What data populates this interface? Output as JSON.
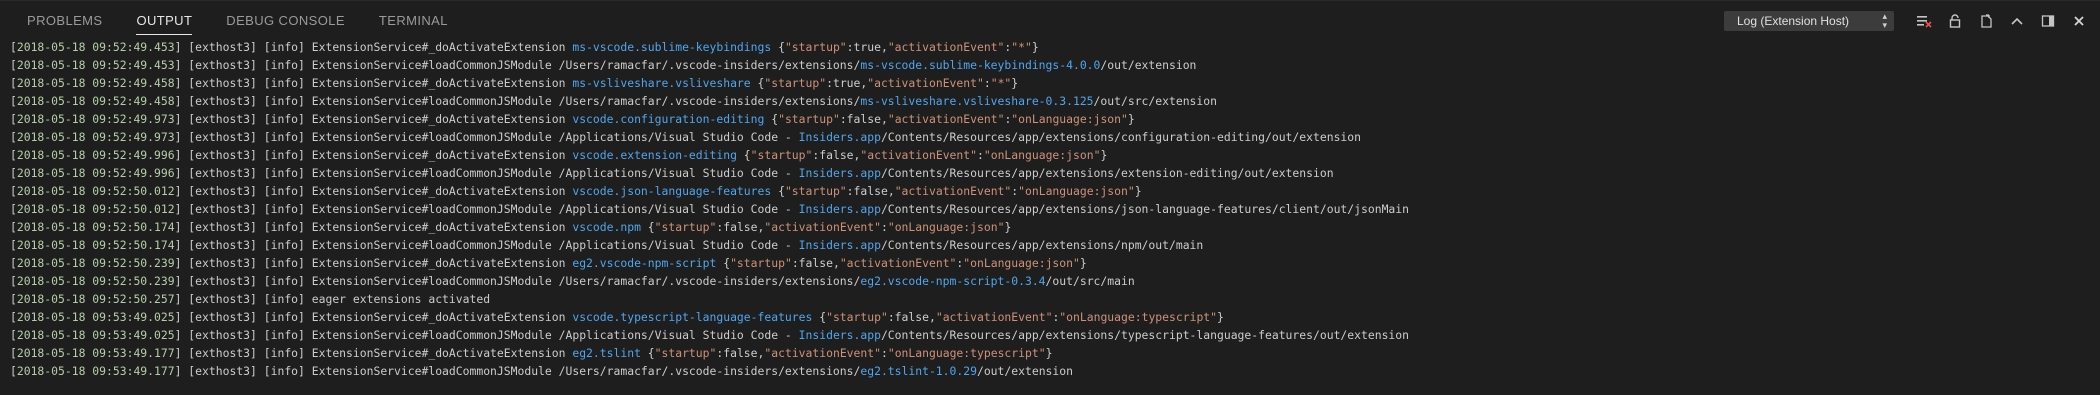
{
  "tabs": [
    {
      "label": "PROBLEMS",
      "active": false
    },
    {
      "label": "OUTPUT",
      "active": true
    },
    {
      "label": "DEBUG CONSOLE",
      "active": false
    },
    {
      "label": "TERMINAL",
      "active": false
    }
  ],
  "channel_select": {
    "selected": "Log (Extension Host)"
  },
  "toolbar_icons": [
    "clear-output-icon",
    "lock-scroll-icon",
    "open-log-file-icon",
    "maximize-panel-icon",
    "toggle-panel-position-icon",
    "close-panel-icon"
  ],
  "colors": {
    "background": "#1e1e1e",
    "timestamp": "#b5cea8",
    "string": "#ce9178",
    "link": "#4fa6ee"
  },
  "log_lines": [
    [
      {
        "t": "[",
        "c": ""
      },
      {
        "t": "2018-05-18 09:52:49.453",
        "c": "ts"
      },
      {
        "t": "] [exthost3] [info] ExtensionService#_doActivateExtension ",
        "c": ""
      },
      {
        "t": "ms-vscode.sublime-keybindings",
        "c": "lnk"
      },
      {
        "t": " {",
        "c": ""
      },
      {
        "t": "\"startup\"",
        "c": "str"
      },
      {
        "t": ":true,",
        "c": ""
      },
      {
        "t": "\"activationEvent\"",
        "c": "str"
      },
      {
        "t": ":",
        "c": ""
      },
      {
        "t": "\"*\"",
        "c": "str"
      },
      {
        "t": "}",
        "c": ""
      }
    ],
    [
      {
        "t": "[",
        "c": ""
      },
      {
        "t": "2018-05-18 09:52:49.453",
        "c": "ts"
      },
      {
        "t": "] [exthost3] [info] ExtensionService#loadCommonJSModule /Users/ramacfar/.vscode-insiders/extensions/",
        "c": ""
      },
      {
        "t": "ms-vscode.sublime-keybindings-4.0.0",
        "c": "lnk"
      },
      {
        "t": "/out/extension",
        "c": ""
      }
    ],
    [
      {
        "t": "[",
        "c": ""
      },
      {
        "t": "2018-05-18 09:52:49.458",
        "c": "ts"
      },
      {
        "t": "] [exthost3] [info] ExtensionService#_doActivateExtension ",
        "c": ""
      },
      {
        "t": "ms-vsliveshare.vsliveshare",
        "c": "lnk"
      },
      {
        "t": " {",
        "c": ""
      },
      {
        "t": "\"startup\"",
        "c": "str"
      },
      {
        "t": ":true,",
        "c": ""
      },
      {
        "t": "\"activationEvent\"",
        "c": "str"
      },
      {
        "t": ":",
        "c": ""
      },
      {
        "t": "\"*\"",
        "c": "str"
      },
      {
        "t": "}",
        "c": ""
      }
    ],
    [
      {
        "t": "[",
        "c": ""
      },
      {
        "t": "2018-05-18 09:52:49.458",
        "c": "ts"
      },
      {
        "t": "] [exthost3] [info] ExtensionService#loadCommonJSModule /Users/ramacfar/.vscode-insiders/extensions/",
        "c": ""
      },
      {
        "t": "ms-vsliveshare.vsliveshare-0.3.125",
        "c": "lnk"
      },
      {
        "t": "/out/src/extension",
        "c": ""
      }
    ],
    [
      {
        "t": "[",
        "c": ""
      },
      {
        "t": "2018-05-18 09:52:49.973",
        "c": "ts"
      },
      {
        "t": "] [exthost3] [info] ExtensionService#_doActivateExtension ",
        "c": ""
      },
      {
        "t": "vscode.configuration-editing",
        "c": "lnk"
      },
      {
        "t": " {",
        "c": ""
      },
      {
        "t": "\"startup\"",
        "c": "str"
      },
      {
        "t": ":false,",
        "c": ""
      },
      {
        "t": "\"activationEvent\"",
        "c": "str"
      },
      {
        "t": ":",
        "c": ""
      },
      {
        "t": "\"onLanguage:json\"",
        "c": "str"
      },
      {
        "t": "}",
        "c": ""
      }
    ],
    [
      {
        "t": "[",
        "c": ""
      },
      {
        "t": "2018-05-18 09:52:49.973",
        "c": "ts"
      },
      {
        "t": "] [exthost3] [info] ExtensionService#loadCommonJSModule /Applications/Visual Studio Code - ",
        "c": ""
      },
      {
        "t": "Insiders.app",
        "c": "lnk"
      },
      {
        "t": "/Contents/Resources/app/extensions/configuration-editing/out/extension",
        "c": ""
      }
    ],
    [
      {
        "t": "[",
        "c": ""
      },
      {
        "t": "2018-05-18 09:52:49.996",
        "c": "ts"
      },
      {
        "t": "] [exthost3] [info] ExtensionService#_doActivateExtension ",
        "c": ""
      },
      {
        "t": "vscode.extension-editing",
        "c": "lnk"
      },
      {
        "t": " {",
        "c": ""
      },
      {
        "t": "\"startup\"",
        "c": "str"
      },
      {
        "t": ":false,",
        "c": ""
      },
      {
        "t": "\"activationEvent\"",
        "c": "str"
      },
      {
        "t": ":",
        "c": ""
      },
      {
        "t": "\"onLanguage:json\"",
        "c": "str"
      },
      {
        "t": "}",
        "c": ""
      }
    ],
    [
      {
        "t": "[",
        "c": ""
      },
      {
        "t": "2018-05-18 09:52:49.996",
        "c": "ts"
      },
      {
        "t": "] [exthost3] [info] ExtensionService#loadCommonJSModule /Applications/Visual Studio Code - ",
        "c": ""
      },
      {
        "t": "Insiders.app",
        "c": "lnk"
      },
      {
        "t": "/Contents/Resources/app/extensions/extension-editing/out/extension",
        "c": ""
      }
    ],
    [
      {
        "t": "[",
        "c": ""
      },
      {
        "t": "2018-05-18 09:52:50.012",
        "c": "ts"
      },
      {
        "t": "] [exthost3] [info] ExtensionService#_doActivateExtension ",
        "c": ""
      },
      {
        "t": "vscode.json-language-features",
        "c": "lnk"
      },
      {
        "t": " {",
        "c": ""
      },
      {
        "t": "\"startup\"",
        "c": "str"
      },
      {
        "t": ":false,",
        "c": ""
      },
      {
        "t": "\"activationEvent\"",
        "c": "str"
      },
      {
        "t": ":",
        "c": ""
      },
      {
        "t": "\"onLanguage:json\"",
        "c": "str"
      },
      {
        "t": "}",
        "c": ""
      }
    ],
    [
      {
        "t": "[",
        "c": ""
      },
      {
        "t": "2018-05-18 09:52:50.012",
        "c": "ts"
      },
      {
        "t": "] [exthost3] [info] ExtensionService#loadCommonJSModule /Applications/Visual Studio Code - ",
        "c": ""
      },
      {
        "t": "Insiders.app",
        "c": "lnk"
      },
      {
        "t": "/Contents/Resources/app/extensions/json-language-features/client/out/jsonMain",
        "c": ""
      }
    ],
    [
      {
        "t": "[",
        "c": ""
      },
      {
        "t": "2018-05-18 09:52:50.174",
        "c": "ts"
      },
      {
        "t": "] [exthost3] [info] ExtensionService#_doActivateExtension ",
        "c": ""
      },
      {
        "t": "vscode.npm",
        "c": "lnk"
      },
      {
        "t": " {",
        "c": ""
      },
      {
        "t": "\"startup\"",
        "c": "str"
      },
      {
        "t": ":false,",
        "c": ""
      },
      {
        "t": "\"activationEvent\"",
        "c": "str"
      },
      {
        "t": ":",
        "c": ""
      },
      {
        "t": "\"onLanguage:json\"",
        "c": "str"
      },
      {
        "t": "}",
        "c": ""
      }
    ],
    [
      {
        "t": "[",
        "c": ""
      },
      {
        "t": "2018-05-18 09:52:50.174",
        "c": "ts"
      },
      {
        "t": "] [exthost3] [info] ExtensionService#loadCommonJSModule /Applications/Visual Studio Code - ",
        "c": ""
      },
      {
        "t": "Insiders.app",
        "c": "lnk"
      },
      {
        "t": "/Contents/Resources/app/extensions/npm/out/main",
        "c": ""
      }
    ],
    [
      {
        "t": "[",
        "c": ""
      },
      {
        "t": "2018-05-18 09:52:50.239",
        "c": "ts"
      },
      {
        "t": "] [exthost3] [info] ExtensionService#_doActivateExtension ",
        "c": ""
      },
      {
        "t": "eg2.vscode-npm-script",
        "c": "lnk"
      },
      {
        "t": " {",
        "c": ""
      },
      {
        "t": "\"startup\"",
        "c": "str"
      },
      {
        "t": ":false,",
        "c": ""
      },
      {
        "t": "\"activationEvent\"",
        "c": "str"
      },
      {
        "t": ":",
        "c": ""
      },
      {
        "t": "\"onLanguage:json\"",
        "c": "str"
      },
      {
        "t": "}",
        "c": ""
      }
    ],
    [
      {
        "t": "[",
        "c": ""
      },
      {
        "t": "2018-05-18 09:52:50.239",
        "c": "ts"
      },
      {
        "t": "] [exthost3] [info] ExtensionService#loadCommonJSModule /Users/ramacfar/.vscode-insiders/extensions/",
        "c": ""
      },
      {
        "t": "eg2.vscode-npm-script-0.3.4",
        "c": "lnk"
      },
      {
        "t": "/out/src/main",
        "c": ""
      }
    ],
    [
      {
        "t": "[",
        "c": ""
      },
      {
        "t": "2018-05-18 09:52:50.257",
        "c": "ts"
      },
      {
        "t": "] [exthost3] [info] eager extensions activated",
        "c": ""
      }
    ],
    [
      {
        "t": "[",
        "c": ""
      },
      {
        "t": "2018-05-18 09:53:49.025",
        "c": "ts"
      },
      {
        "t": "] [exthost3] [info] ExtensionService#_doActivateExtension ",
        "c": ""
      },
      {
        "t": "vscode.typescript-language-features",
        "c": "lnk"
      },
      {
        "t": " {",
        "c": ""
      },
      {
        "t": "\"startup\"",
        "c": "str"
      },
      {
        "t": ":false,",
        "c": ""
      },
      {
        "t": "\"activationEvent\"",
        "c": "str"
      },
      {
        "t": ":",
        "c": ""
      },
      {
        "t": "\"onLanguage:typescript\"",
        "c": "str"
      },
      {
        "t": "}",
        "c": ""
      }
    ],
    [
      {
        "t": "[",
        "c": ""
      },
      {
        "t": "2018-05-18 09:53:49.025",
        "c": "ts"
      },
      {
        "t": "] [exthost3] [info] ExtensionService#loadCommonJSModule /Applications/Visual Studio Code - ",
        "c": ""
      },
      {
        "t": "Insiders.app",
        "c": "lnk"
      },
      {
        "t": "/Contents/Resources/app/extensions/typescript-language-features/out/extension",
        "c": ""
      }
    ],
    [
      {
        "t": "[",
        "c": ""
      },
      {
        "t": "2018-05-18 09:53:49.177",
        "c": "ts"
      },
      {
        "t": "] [exthost3] [info] ExtensionService#_doActivateExtension ",
        "c": ""
      },
      {
        "t": "eg2.tslint",
        "c": "lnk"
      },
      {
        "t": " {",
        "c": ""
      },
      {
        "t": "\"startup\"",
        "c": "str"
      },
      {
        "t": ":false,",
        "c": ""
      },
      {
        "t": "\"activationEvent\"",
        "c": "str"
      },
      {
        "t": ":",
        "c": ""
      },
      {
        "t": "\"onLanguage:typescript\"",
        "c": "str"
      },
      {
        "t": "}",
        "c": ""
      }
    ],
    [
      {
        "t": "[",
        "c": ""
      },
      {
        "t": "2018-05-18 09:53:49.177",
        "c": "ts"
      },
      {
        "t": "] [exthost3] [info] ExtensionService#loadCommonJSModule /Users/ramacfar/.vscode-insiders/extensions/",
        "c": ""
      },
      {
        "t": "eg2.tslint-1.0.29",
        "c": "lnk"
      },
      {
        "t": "/out/extension",
        "c": ""
      }
    ]
  ]
}
